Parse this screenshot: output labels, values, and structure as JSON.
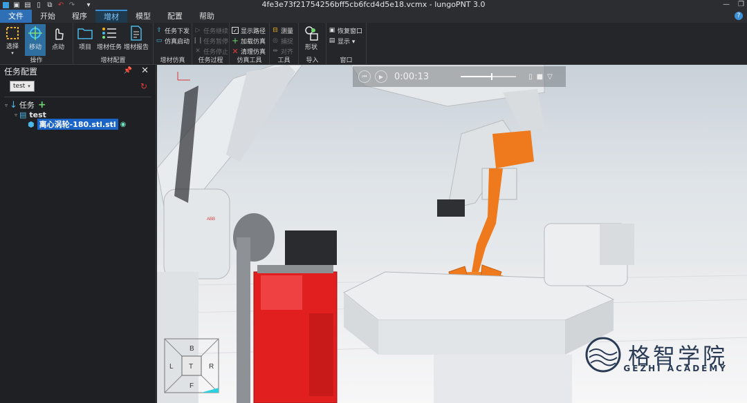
{
  "window": {
    "title": "4fe3e73f21754256bff5cb6fcd4d5e18.vcmx - lungoPNT 3.0"
  },
  "menu": {
    "tabs": [
      {
        "label": "文件"
      },
      {
        "label": "开始"
      },
      {
        "label": "程序"
      },
      {
        "label": "增材"
      },
      {
        "label": "模型"
      },
      {
        "label": "配置"
      },
      {
        "label": "帮助"
      }
    ],
    "active": "增材",
    "help": "?"
  },
  "ribbon": {
    "ops": {
      "label": "操作",
      "select": "选择",
      "move": "移动",
      "jog": "点动"
    },
    "am_config": {
      "label": "增材配置",
      "project": "项目",
      "am_task": "增材任务",
      "am_report": "增材报告"
    },
    "am_sim": {
      "label": "增材仿真",
      "task_send": "任务下发",
      "sim_start": "仿真启动"
    },
    "task_proc": {
      "label": "任务过程",
      "resume": "任务继续",
      "pause": "任务暂停",
      "stop": "任务停止"
    },
    "sim_tools": {
      "label": "仿真工具",
      "show_path": "显示路径",
      "load_sim": "加载仿真",
      "clear_sim": "清理仿真"
    },
    "tools": {
      "label": "工具",
      "measure": "测量",
      "snap": "捕捉",
      "align": "对齐"
    },
    "import": {
      "label": "导入",
      "shape": "形状"
    },
    "window": {
      "label": "窗口",
      "restore": "恢复窗口",
      "display": "显示 ▾"
    }
  },
  "panel": {
    "title": "任务配置",
    "dropdown_value": "test",
    "tree": {
      "root": "任务",
      "child": "test",
      "file": "离心涡轮-180.stl.stl"
    }
  },
  "simulation": {
    "time": "0:00:13",
    "progress": 0.55
  },
  "viewcube": {
    "top": "B",
    "left": "L",
    "center": "T",
    "right": "R",
    "bottom": "F"
  },
  "robot_brand": "ABB",
  "watermark": {
    "cn": "格智学院",
    "en": "GEZHI ACADEMY"
  },
  "colors": {
    "accent": "#2f6fb5",
    "robot": "#e9ecee",
    "torch": "#ef7a1d",
    "welder": "#e21f1f"
  }
}
